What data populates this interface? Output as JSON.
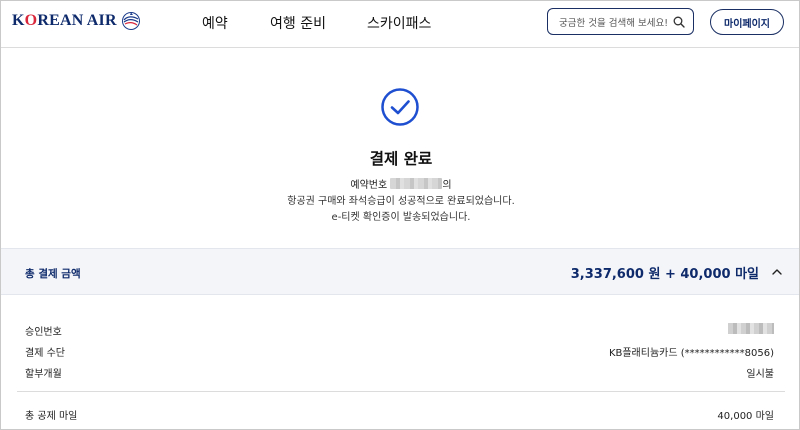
{
  "header": {
    "brand": "KOREAN AIR",
    "nav": [
      "예약",
      "여행 준비",
      "스카이패스"
    ],
    "search_placeholder": "궁금한 것을 검색해 보세요!",
    "mypage_label": "마이페이지"
  },
  "confirmation": {
    "title": "결제 완료",
    "booking_prefix": "예약번호",
    "booking_suffix": "의",
    "message_line1": "항공권 구매와 좌석승급이 성공적으로 완료되었습니다.",
    "message_line2": "e-티켓 확인증이 발송되었습니다."
  },
  "total": {
    "label": "총 결제 금액",
    "value": "3,337,600 원 + 40,000 마일"
  },
  "details": {
    "approval_label": "승인번호",
    "method_label": "결제 수단",
    "method_value": "KB플래티늄카드 (************8056)",
    "installment_label": "할부개월",
    "installment_value": "일시불",
    "miles_label": "총 공제 마일",
    "miles_value": "40,000 마일"
  },
  "colors": {
    "brand_navy": "#0e2a6b",
    "brand_red": "#d9263a",
    "check_blue": "#1f4fd1",
    "total_bg": "#f4f5f9"
  },
  "icons": [
    "korean-air-emblem-icon",
    "search-icon",
    "check-circle-icon",
    "chevron-up-icon"
  ]
}
